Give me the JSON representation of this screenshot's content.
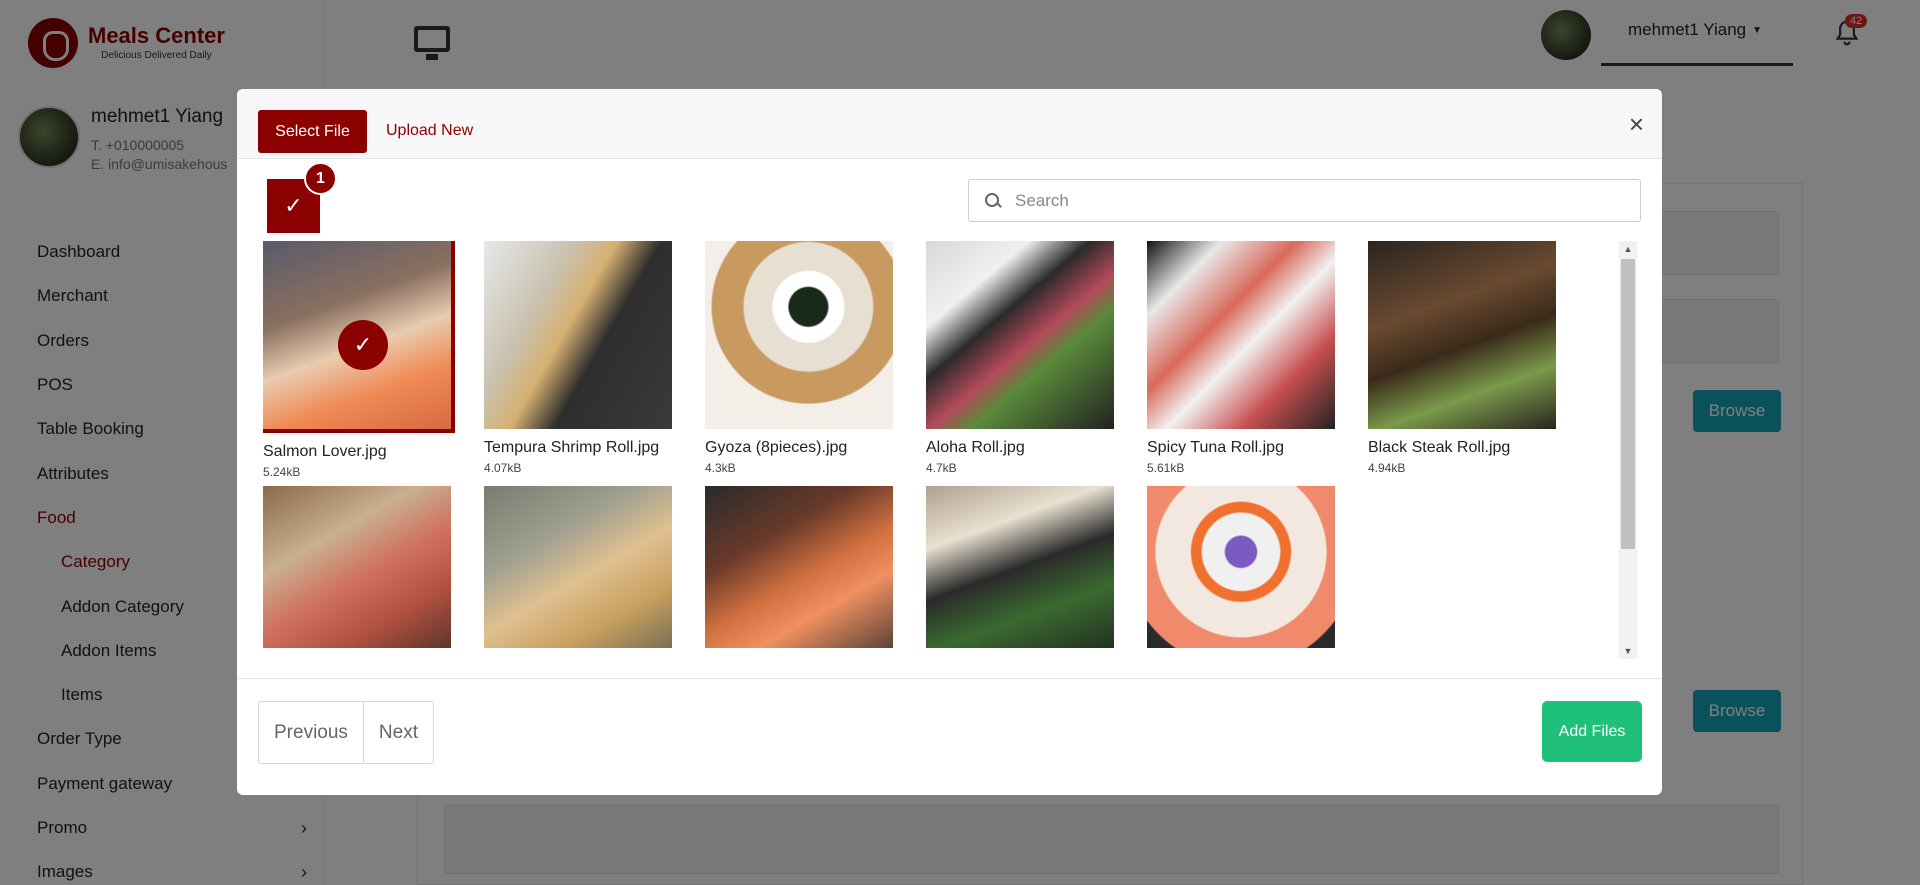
{
  "app": {
    "logo_title": "Meals Center",
    "logo_subtitle": "Delicious Delivered Daily",
    "user_name": "mehmet1 Yiang",
    "phone": "T. +010000005",
    "email": "E. info@umisakehous",
    "notification_count": "42"
  },
  "sidebar": {
    "items": [
      {
        "label": "Dashboard"
      },
      {
        "label": "Merchant"
      },
      {
        "label": "Orders"
      },
      {
        "label": "POS"
      },
      {
        "label": "Table Booking"
      },
      {
        "label": "Attributes"
      },
      {
        "label": "Food"
      },
      {
        "label": "Category"
      },
      {
        "label": "Addon Category"
      },
      {
        "label": "Addon Items"
      },
      {
        "label": "Items"
      },
      {
        "label": "Order Type"
      },
      {
        "label": "Payment gateway"
      },
      {
        "label": "Promo"
      },
      {
        "label": "Images"
      }
    ]
  },
  "page": {
    "browse_label_1": "Browse",
    "browse_label_2": "Browse"
  },
  "modal": {
    "tab_select": "Select File",
    "tab_upload": "Upload New",
    "close": "×",
    "selected_count": "1",
    "search_placeholder": "Search",
    "files": [
      {
        "name": "Salmon Lover.jpg",
        "size": "5.24kB",
        "selected": true
      },
      {
        "name": "Tempura Shrimp Roll.jpg",
        "size": "4.07kB"
      },
      {
        "name": "Gyoza (8pieces).jpg",
        "size": "4.3kB"
      },
      {
        "name": "Aloha Roll.jpg",
        "size": "4.7kB"
      },
      {
        "name": "Spicy Tuna Roll.jpg",
        "size": "5.61kB"
      },
      {
        "name": "Black Steak Roll.jpg",
        "size": "4.94kB"
      },
      {
        "name": "",
        "size": ""
      },
      {
        "name": "",
        "size": ""
      },
      {
        "name": "",
        "size": ""
      },
      {
        "name": "",
        "size": ""
      },
      {
        "name": "",
        "size": ""
      }
    ],
    "previous": "Previous",
    "next": "Next",
    "add_files": "Add Files"
  },
  "colors": {
    "brand": "#8b0000",
    "success": "#1fc17a",
    "info": "#17a2b8"
  }
}
